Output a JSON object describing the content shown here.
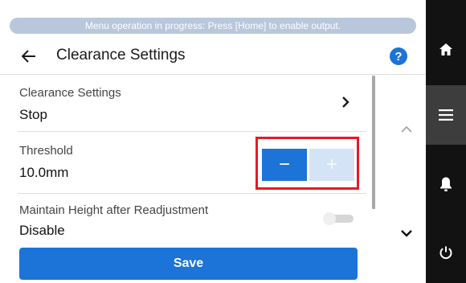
{
  "banner": {
    "text": "Menu operation in progress: Press [Home] to enable output."
  },
  "header": {
    "title": "Clearance Settings",
    "back_icon": "arrow-left-icon",
    "help_label": "?"
  },
  "settings": [
    {
      "label": "Clearance Settings",
      "value": "Stop",
      "control": "chevron-right-icon"
    },
    {
      "label": "Threshold",
      "value": "10.0mm",
      "control": "stepper",
      "minus_label": "−",
      "plus_label": "+",
      "plus_enabled": false,
      "highlighted": true
    },
    {
      "label": "Maintain Height after Readjustment",
      "value": "Disable",
      "control": "toggle",
      "toggle_on": false
    }
  ],
  "save_button": {
    "label": "Save"
  },
  "scroll": {
    "up_icon": "chevron-up-icon",
    "down_icon": "chevron-down-icon"
  },
  "sidebar": [
    {
      "name": "home",
      "icon": "home-icon",
      "active": false
    },
    {
      "name": "menu",
      "icon": "menu-icon",
      "active": true
    },
    {
      "name": "notifications",
      "icon": "bell-icon",
      "active": false
    },
    {
      "name": "power",
      "icon": "power-icon",
      "active": false
    }
  ],
  "colors": {
    "accent": "#1c73d8",
    "highlight": "#e31b23",
    "banner_bg": "#b8c7dc",
    "sidebar_bg": "#121212",
    "sidebar_active": "#3d3d3d"
  }
}
